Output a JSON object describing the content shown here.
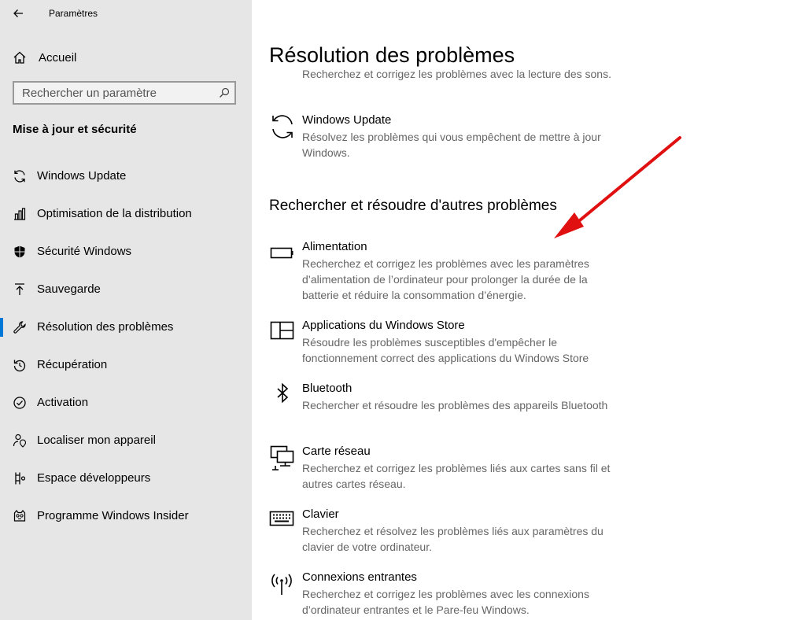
{
  "window": {
    "title": "Paramètres"
  },
  "sidebar": {
    "home_label": "Accueil",
    "search_placeholder": "Rechercher un paramètre",
    "section_title": "Mise à jour et sécurité",
    "items": [
      {
        "label": "Windows Update",
        "icon": "sync-icon"
      },
      {
        "label": "Optimisation de la distribution",
        "icon": "delivery-optimization-icon"
      },
      {
        "label": "Sécurité Windows",
        "icon": "shield-icon"
      },
      {
        "label": "Sauvegarde",
        "icon": "backup-arrow-icon"
      },
      {
        "label": "Résolution des problèmes",
        "icon": "wrench-icon",
        "selected": true
      },
      {
        "label": "Récupération",
        "icon": "recovery-icon"
      },
      {
        "label": "Activation",
        "icon": "check-circle-icon"
      },
      {
        "label": "Localiser mon appareil",
        "icon": "person-pin-icon"
      },
      {
        "label": "Espace développeurs",
        "icon": "developer-icon"
      },
      {
        "label": "Programme Windows Insider",
        "icon": "insider-cat-icon"
      }
    ],
    "accent_color": "#0078d7"
  },
  "main": {
    "title": "Résolution des problèmes",
    "partial_item_desc": "Recherchez et corrigez les problèmes avec la lecture des sons.",
    "top_items": [
      {
        "name": "Windows Update",
        "desc": "Résolvez les problèmes qui vous empêchent de mettre à jour Windows.",
        "icon": "sync-icon"
      }
    ],
    "group_title": "Rechercher et résoudre d'autres problèmes",
    "items": [
      {
        "name": "Alimentation",
        "desc": "Recherchez et corrigez les problèmes avec les paramètres d’alimentation de l’ordinateur pour prolonger la durée de la batterie et réduire la consommation d’énergie.",
        "icon": "battery-icon"
      },
      {
        "name": "Applications du Windows Store",
        "desc": "Résoudre les problèmes susceptibles d'empêcher le fonctionnement correct des applications du Windows Store",
        "icon": "store-app-icon"
      },
      {
        "name": "Bluetooth",
        "desc": "Rechercher et résoudre les problèmes des appareils Bluetooth",
        "icon": "bluetooth-icon"
      },
      {
        "name": "Carte réseau",
        "desc": "Recherchez et corrigez les problèmes liés aux cartes sans fil et autres cartes réseau.",
        "icon": "network-adapter-icon"
      },
      {
        "name": "Clavier",
        "desc": "Recherchez et résolvez les problèmes liés aux paramètres du clavier de votre ordinateur.",
        "icon": "keyboard-icon"
      },
      {
        "name": "Connexions entrantes",
        "desc": "Recherchez et corrigez les problèmes avec les connexions d’ordinateur entrantes et le Pare-feu Windows.",
        "icon": "antenna-icon"
      }
    ],
    "annotation_color": "#e01010"
  }
}
